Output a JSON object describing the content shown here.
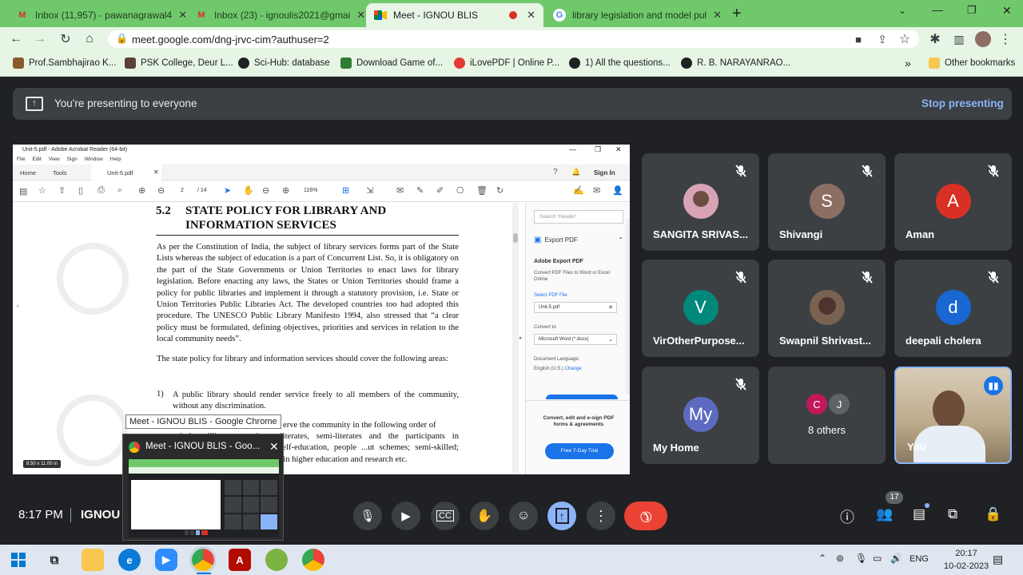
{
  "browser": {
    "tabs": [
      {
        "title": "Inbox (11,957) - pawanagrawal4",
        "icon": "gmail-icon"
      },
      {
        "title": "Inbox (23) - ignoulis2021@gmai",
        "icon": "gmail-icon"
      },
      {
        "title": "Meet - IGNOU BLIS",
        "icon": "meet-icon",
        "active": true
      },
      {
        "title": "library legislation and model pul",
        "icon": "google-icon"
      }
    ],
    "new_tab": "+",
    "url": "meet.google.com/dng-jrvc-cim?authuser=2",
    "bookmarks": [
      "Prof.Sambhajirao K...",
      "PSK College, Deur L...",
      "Sci-Hub: database",
      "Download Game of...",
      "iLovePDF | Online P...",
      "1) All the questions...",
      "R. B. NARAYANRAO..."
    ],
    "overflow": "»",
    "other_bookmarks": "Other bookmarks"
  },
  "meet": {
    "banner_text": "You're presenting to everyone",
    "stop_label": "Stop presenting",
    "time": "8:17 PM",
    "meeting_name": "IGNOU",
    "people_count": "17",
    "participants": [
      {
        "name": "SANGITA SRIVAS...",
        "avatar": "photo",
        "color": "#d9a3b6"
      },
      {
        "name": "Shivangi",
        "avatar": "S",
        "color": "#8d6e63"
      },
      {
        "name": "Aman",
        "avatar": "A",
        "color": "#d93025"
      },
      {
        "name": "VirOtherPurpose...",
        "avatar": "V",
        "color": "#00897b"
      },
      {
        "name": "Swapnil Shrivast...",
        "avatar": "photo",
        "color": "#7a6250"
      },
      {
        "name": "deepali cholera",
        "avatar": "d",
        "color": "#1967d2"
      },
      {
        "name": "My Home",
        "avatar": "My",
        "color": "#5c6bc0"
      },
      {
        "name": "8 others",
        "avatar": "C J",
        "color": "#c2185b"
      },
      {
        "name": "You",
        "avatar": "video",
        "color": "#8ab4f8"
      }
    ],
    "window_tooltip": "Meet - IGNOU BLIS - Google Chrome",
    "thumb_title": "Meet - IGNOU BLIS - Goo..."
  },
  "pdf": {
    "window_title": "Unit-5.pdf - Adobe Acrobat Reader (64-bit)",
    "menu": [
      "File",
      "Edit",
      "View",
      "Sign",
      "Window",
      "Help"
    ],
    "tabs": [
      "Home",
      "Tools",
      "Unit-5.pdf"
    ],
    "sign_in": "Sign In",
    "page": "2",
    "pages": "/ 14",
    "zoom": "116%",
    "section_num": "5.2",
    "heading_line1": "STATE POLICY FOR LIBRARY AND",
    "heading_line2": "INFORMATION SERVICES",
    "para1": "As per the Constitution of India, the subject of library services forms part of the State Lists whereas the subject of education is a part of Concurrent List. So, it is obligatory on the part of the State Governments or Union Territories to enact laws for library legislation. Before enacting any laws, the States or Union Territories should frame a policy for public libraries and implement it through a statutory provision, i.e. State or Union Territories Public Libraries Act. The developed countries too had adopted this procedure. The UNESCO Public Library Manifesto 1994, also stressed that “a clear policy must be formulated, defining objectives, priorities and services in relation to the local community needs”.",
    "para2": "The state policy for library and information services should cover the following areas:",
    "item1_num": "1)",
    "item1": "A public library should render service freely to all members of the community, without any discrimination.",
    "item2_tail": "erve the community in the following order of",
    "item2_rest": "priority: illiterates and neo-literates, semi-literates and the participants in ...grammes; people pursuing self-education, people ...ut schemes; semi-skilled; children and young; ...and those in higher education and research etc.",
    "page_size": "8.50 x 11.00 in",
    "panel": {
      "search": "Search 'Header'",
      "export": "Export PDF",
      "adobe_export": "Adobe Export PDF",
      "desc": "Convert PDF Files to Word or Excel Online",
      "select": "Select PDF File",
      "file": "Unit-5.pdf",
      "convert_to": "Convert to",
      "format": "Microsoft Word (*.docx)",
      "lang_label": "Document Language:",
      "lang": "English (U.S.)",
      "change": "Change",
      "promo": "Convert, edit and e-sign PDF forms & agreements",
      "trial": "Free 7-Day Trial"
    }
  },
  "taskbar": {
    "lang": "ENG",
    "time": "20:17",
    "date": "10-02-2023"
  }
}
